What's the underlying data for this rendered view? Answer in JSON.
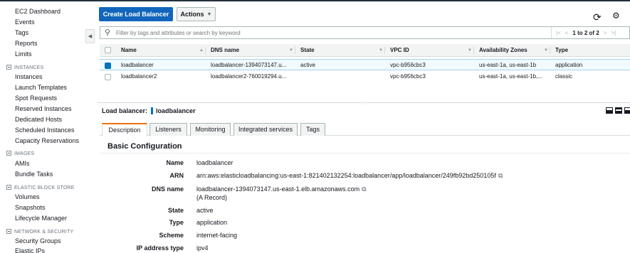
{
  "sidebar": {
    "items": [
      {
        "label": "EC2 Dashboard"
      },
      {
        "label": "Events"
      },
      {
        "label": "Tags"
      },
      {
        "label": "Reports"
      },
      {
        "label": "Limits"
      }
    ],
    "sections": [
      {
        "title": "INSTANCES",
        "items": [
          "Instances",
          "Launch Templates",
          "Spot Requests",
          "Reserved Instances",
          "Dedicated Hosts",
          "Scheduled Instances",
          "Capacity Reservations"
        ]
      },
      {
        "title": "IMAGES",
        "items": [
          "AMIs",
          "Bundle Tasks"
        ]
      },
      {
        "title": "ELASTIC BLOCK STORE",
        "items": [
          "Volumes",
          "Snapshots",
          "Lifecycle Manager"
        ]
      },
      {
        "title": "NETWORK & SECURITY",
        "items": [
          "Security Groups",
          "Elastic IPs"
        ]
      }
    ],
    "collapse_glyph": "◀"
  },
  "toolbar": {
    "create_label": "Create Load Balancer",
    "actions_label": "Actions",
    "refresh_icon": "refresh-icon",
    "settings_icon": "gear-icon"
  },
  "filter": {
    "placeholder": "Filter by tags and attributes or search by keyword",
    "pagination": "1 to 2 of 2"
  },
  "table": {
    "columns": [
      "Name",
      "DNS name",
      "State",
      "VPC ID",
      "Availability Zones",
      "Type"
    ],
    "rows": [
      {
        "name": "loadbalancer",
        "dns": "loadbalancer-1394073147.u...",
        "state": "active",
        "vpc": "vpc-b956cbc3",
        "az": "us-east-1a, us-east-1b",
        "type": "application",
        "selected": true
      },
      {
        "name": "loadbalancer2",
        "dns": "loadbalancer2-760019294.u...",
        "state": "",
        "vpc": "vpc-b956cbc3",
        "az": "us-east-1a, us-east-1b,...",
        "type": "classic",
        "selected": false
      }
    ]
  },
  "detail": {
    "label": "Load balancer:",
    "value": "loadbalancer",
    "tabs": [
      "Description",
      "Listeners",
      "Monitoring",
      "Integrated services",
      "Tags"
    ],
    "active_tab": "Description",
    "section_title": "Basic Configuration",
    "fields": [
      {
        "label": "Name",
        "value": "loadbalancer"
      },
      {
        "label": "ARN",
        "value": "arn:aws:elasticloadbalancing:us-east-1:821402132254:loadbalancer/app/loadbalancer/249fb92bd250105f"
      },
      {
        "label": "DNS name",
        "value": "loadbalancer-1394073147.us-east-1.elb.amazonaws.com",
        "extra": "(A Record)"
      },
      {
        "label": "State",
        "value": "active"
      },
      {
        "label": "Type",
        "value": "application"
      },
      {
        "label": "Scheme",
        "value": "internet-facing"
      },
      {
        "label": "IP address type",
        "value": "ipv4"
      }
    ]
  },
  "colors": {
    "primary": "#1166bb",
    "accent_tab": "#ec7211",
    "selected_row": "#f1faff"
  }
}
